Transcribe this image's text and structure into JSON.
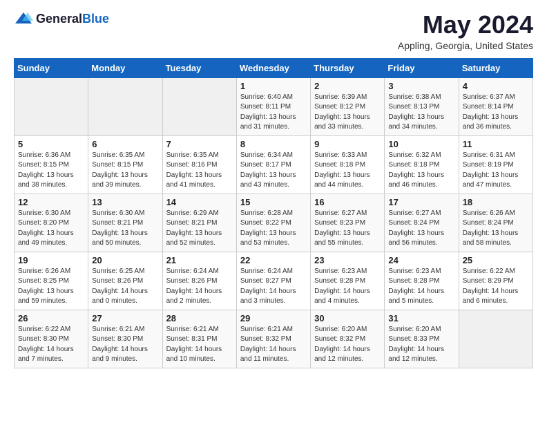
{
  "header": {
    "logo_general": "General",
    "logo_blue": "Blue",
    "title": "May 2024",
    "subtitle": "Appling, Georgia, United States"
  },
  "weekdays": [
    "Sunday",
    "Monday",
    "Tuesday",
    "Wednesday",
    "Thursday",
    "Friday",
    "Saturday"
  ],
  "weeks": [
    [
      {
        "day": "",
        "info": ""
      },
      {
        "day": "",
        "info": ""
      },
      {
        "day": "",
        "info": ""
      },
      {
        "day": "1",
        "info": "Sunrise: 6:40 AM\nSunset: 8:11 PM\nDaylight: 13 hours\nand 31 minutes."
      },
      {
        "day": "2",
        "info": "Sunrise: 6:39 AM\nSunset: 8:12 PM\nDaylight: 13 hours\nand 33 minutes."
      },
      {
        "day": "3",
        "info": "Sunrise: 6:38 AM\nSunset: 8:13 PM\nDaylight: 13 hours\nand 34 minutes."
      },
      {
        "day": "4",
        "info": "Sunrise: 6:37 AM\nSunset: 8:14 PM\nDaylight: 13 hours\nand 36 minutes."
      }
    ],
    [
      {
        "day": "5",
        "info": "Sunrise: 6:36 AM\nSunset: 8:15 PM\nDaylight: 13 hours\nand 38 minutes."
      },
      {
        "day": "6",
        "info": "Sunrise: 6:35 AM\nSunset: 8:15 PM\nDaylight: 13 hours\nand 39 minutes."
      },
      {
        "day": "7",
        "info": "Sunrise: 6:35 AM\nSunset: 8:16 PM\nDaylight: 13 hours\nand 41 minutes."
      },
      {
        "day": "8",
        "info": "Sunrise: 6:34 AM\nSunset: 8:17 PM\nDaylight: 13 hours\nand 43 minutes."
      },
      {
        "day": "9",
        "info": "Sunrise: 6:33 AM\nSunset: 8:18 PM\nDaylight: 13 hours\nand 44 minutes."
      },
      {
        "day": "10",
        "info": "Sunrise: 6:32 AM\nSunset: 8:18 PM\nDaylight: 13 hours\nand 46 minutes."
      },
      {
        "day": "11",
        "info": "Sunrise: 6:31 AM\nSunset: 8:19 PM\nDaylight: 13 hours\nand 47 minutes."
      }
    ],
    [
      {
        "day": "12",
        "info": "Sunrise: 6:30 AM\nSunset: 8:20 PM\nDaylight: 13 hours\nand 49 minutes."
      },
      {
        "day": "13",
        "info": "Sunrise: 6:30 AM\nSunset: 8:21 PM\nDaylight: 13 hours\nand 50 minutes."
      },
      {
        "day": "14",
        "info": "Sunrise: 6:29 AM\nSunset: 8:21 PM\nDaylight: 13 hours\nand 52 minutes."
      },
      {
        "day": "15",
        "info": "Sunrise: 6:28 AM\nSunset: 8:22 PM\nDaylight: 13 hours\nand 53 minutes."
      },
      {
        "day": "16",
        "info": "Sunrise: 6:27 AM\nSunset: 8:23 PM\nDaylight: 13 hours\nand 55 minutes."
      },
      {
        "day": "17",
        "info": "Sunrise: 6:27 AM\nSunset: 8:24 PM\nDaylight: 13 hours\nand 56 minutes."
      },
      {
        "day": "18",
        "info": "Sunrise: 6:26 AM\nSunset: 8:24 PM\nDaylight: 13 hours\nand 58 minutes."
      }
    ],
    [
      {
        "day": "19",
        "info": "Sunrise: 6:26 AM\nSunset: 8:25 PM\nDaylight: 13 hours\nand 59 minutes."
      },
      {
        "day": "20",
        "info": "Sunrise: 6:25 AM\nSunset: 8:26 PM\nDaylight: 14 hours\nand 0 minutes."
      },
      {
        "day": "21",
        "info": "Sunrise: 6:24 AM\nSunset: 8:26 PM\nDaylight: 14 hours\nand 2 minutes."
      },
      {
        "day": "22",
        "info": "Sunrise: 6:24 AM\nSunset: 8:27 PM\nDaylight: 14 hours\nand 3 minutes."
      },
      {
        "day": "23",
        "info": "Sunrise: 6:23 AM\nSunset: 8:28 PM\nDaylight: 14 hours\nand 4 minutes."
      },
      {
        "day": "24",
        "info": "Sunrise: 6:23 AM\nSunset: 8:28 PM\nDaylight: 14 hours\nand 5 minutes."
      },
      {
        "day": "25",
        "info": "Sunrise: 6:22 AM\nSunset: 8:29 PM\nDaylight: 14 hours\nand 6 minutes."
      }
    ],
    [
      {
        "day": "26",
        "info": "Sunrise: 6:22 AM\nSunset: 8:30 PM\nDaylight: 14 hours\nand 7 minutes."
      },
      {
        "day": "27",
        "info": "Sunrise: 6:21 AM\nSunset: 8:30 PM\nDaylight: 14 hours\nand 9 minutes."
      },
      {
        "day": "28",
        "info": "Sunrise: 6:21 AM\nSunset: 8:31 PM\nDaylight: 14 hours\nand 10 minutes."
      },
      {
        "day": "29",
        "info": "Sunrise: 6:21 AM\nSunset: 8:32 PM\nDaylight: 14 hours\nand 11 minutes."
      },
      {
        "day": "30",
        "info": "Sunrise: 6:20 AM\nSunset: 8:32 PM\nDaylight: 14 hours\nand 12 minutes."
      },
      {
        "day": "31",
        "info": "Sunrise: 6:20 AM\nSunset: 8:33 PM\nDaylight: 14 hours\nand 12 minutes."
      },
      {
        "day": "",
        "info": ""
      }
    ]
  ]
}
